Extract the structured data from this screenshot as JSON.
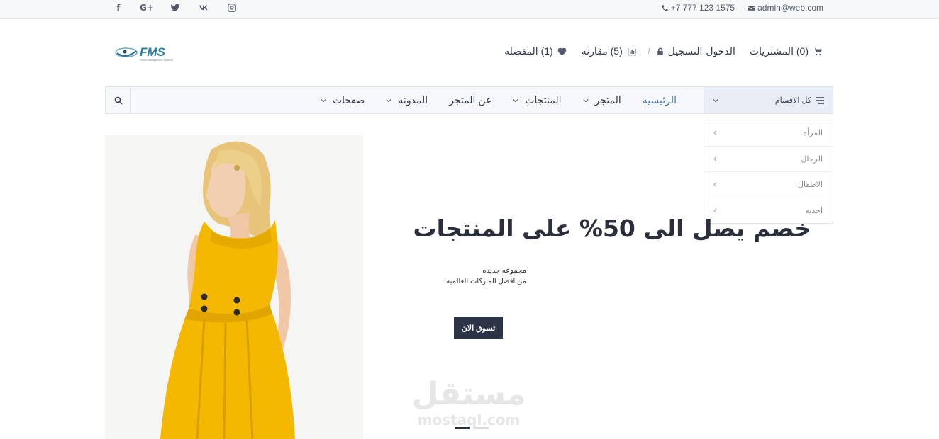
{
  "topbar": {
    "social": [
      {
        "icon": "facebook-icon",
        "glyph": "f"
      },
      {
        "icon": "google-plus-icon",
        "glyph": "G+"
      },
      {
        "icon": "twitter-icon",
        "glyph": ""
      },
      {
        "icon": "vk-icon",
        "glyph": ""
      },
      {
        "icon": "instagram-icon",
        "glyph": ""
      }
    ],
    "phone": "+7 777 123 1575",
    "email": "admin@web.com"
  },
  "header": {
    "logo_text": "FMS",
    "logo_tagline": "Future Management Systems",
    "cart_label": "(0) المشتريات",
    "login_label": "الدخول",
    "register_label": "التسجيل",
    "compare_label": "(5) مقارنه",
    "wishlist_label": "(1) المفضله"
  },
  "nav": {
    "categories_label": "كل الاقسام",
    "items": [
      {
        "label": "الرئيسيه",
        "active": true,
        "has_dropdown": false
      },
      {
        "label": "المتجر",
        "active": false,
        "has_dropdown": true
      },
      {
        "label": "المنتجات",
        "active": false,
        "has_dropdown": true
      },
      {
        "label": "عن المتجر",
        "active": false,
        "has_dropdown": false
      },
      {
        "label": "المدونه",
        "active": false,
        "has_dropdown": true
      },
      {
        "label": "صفحات",
        "active": false,
        "has_dropdown": true
      }
    ]
  },
  "categories": [
    "المرأه",
    "الرجال",
    "الاطفال",
    "احذيه"
  ],
  "hero": {
    "title": "خصم يصل الى 50% على المنتجات",
    "subtitle_line1": "مجموعه جديده",
    "subtitle_line2": "من افضل الماركات العالميه",
    "button_label": "تسوق الان",
    "slides": 2,
    "active_slide": 1
  },
  "watermark": {
    "arabic": "مستقل",
    "latin": "mostaql.com"
  },
  "colors": {
    "accent": "#2e3448",
    "link_active": "#4a76a8",
    "dress": "#f5b800"
  }
}
